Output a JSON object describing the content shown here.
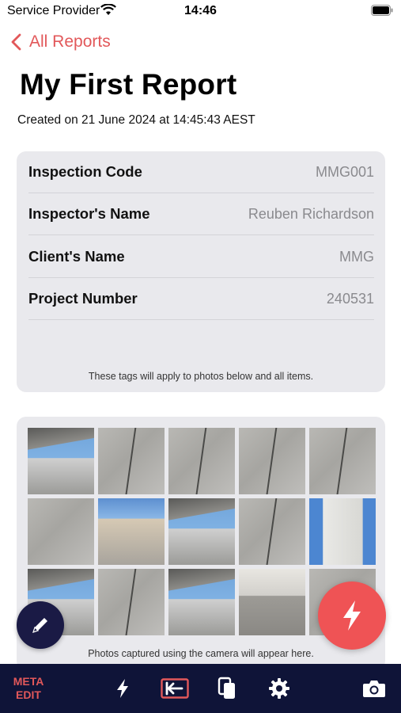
{
  "status_bar": {
    "carrier": "Service Provider",
    "time": "14:46"
  },
  "nav": {
    "back_label": "All Reports"
  },
  "report": {
    "title": "My First Report",
    "created": "Created on 21 June 2024 at 14:45:43 AEST"
  },
  "details": {
    "rows": [
      {
        "label": "Inspection Code",
        "value": "MMG001"
      },
      {
        "label": "Inspector's Name",
        "value": "Reuben Richardson"
      },
      {
        "label": "Client's Name",
        "value": "MMG"
      },
      {
        "label": "Project Number",
        "value": "240531"
      }
    ],
    "note": "These tags will apply to photos below and all items."
  },
  "photos": {
    "note": "Photos captured using the camera will appear here.",
    "count": 15
  },
  "bottom_bar": {
    "meta_line1": "META",
    "meta_line2": "EDIT",
    "icons": [
      "flash-icon",
      "import-icon",
      "copy-icon",
      "gear-icon",
      "camera-icon"
    ]
  },
  "colors": {
    "accent": "#e2585a",
    "nav_bar": "#0f1438",
    "fab_edit": "#1a1a45",
    "fab_flash": "#ef5355"
  }
}
